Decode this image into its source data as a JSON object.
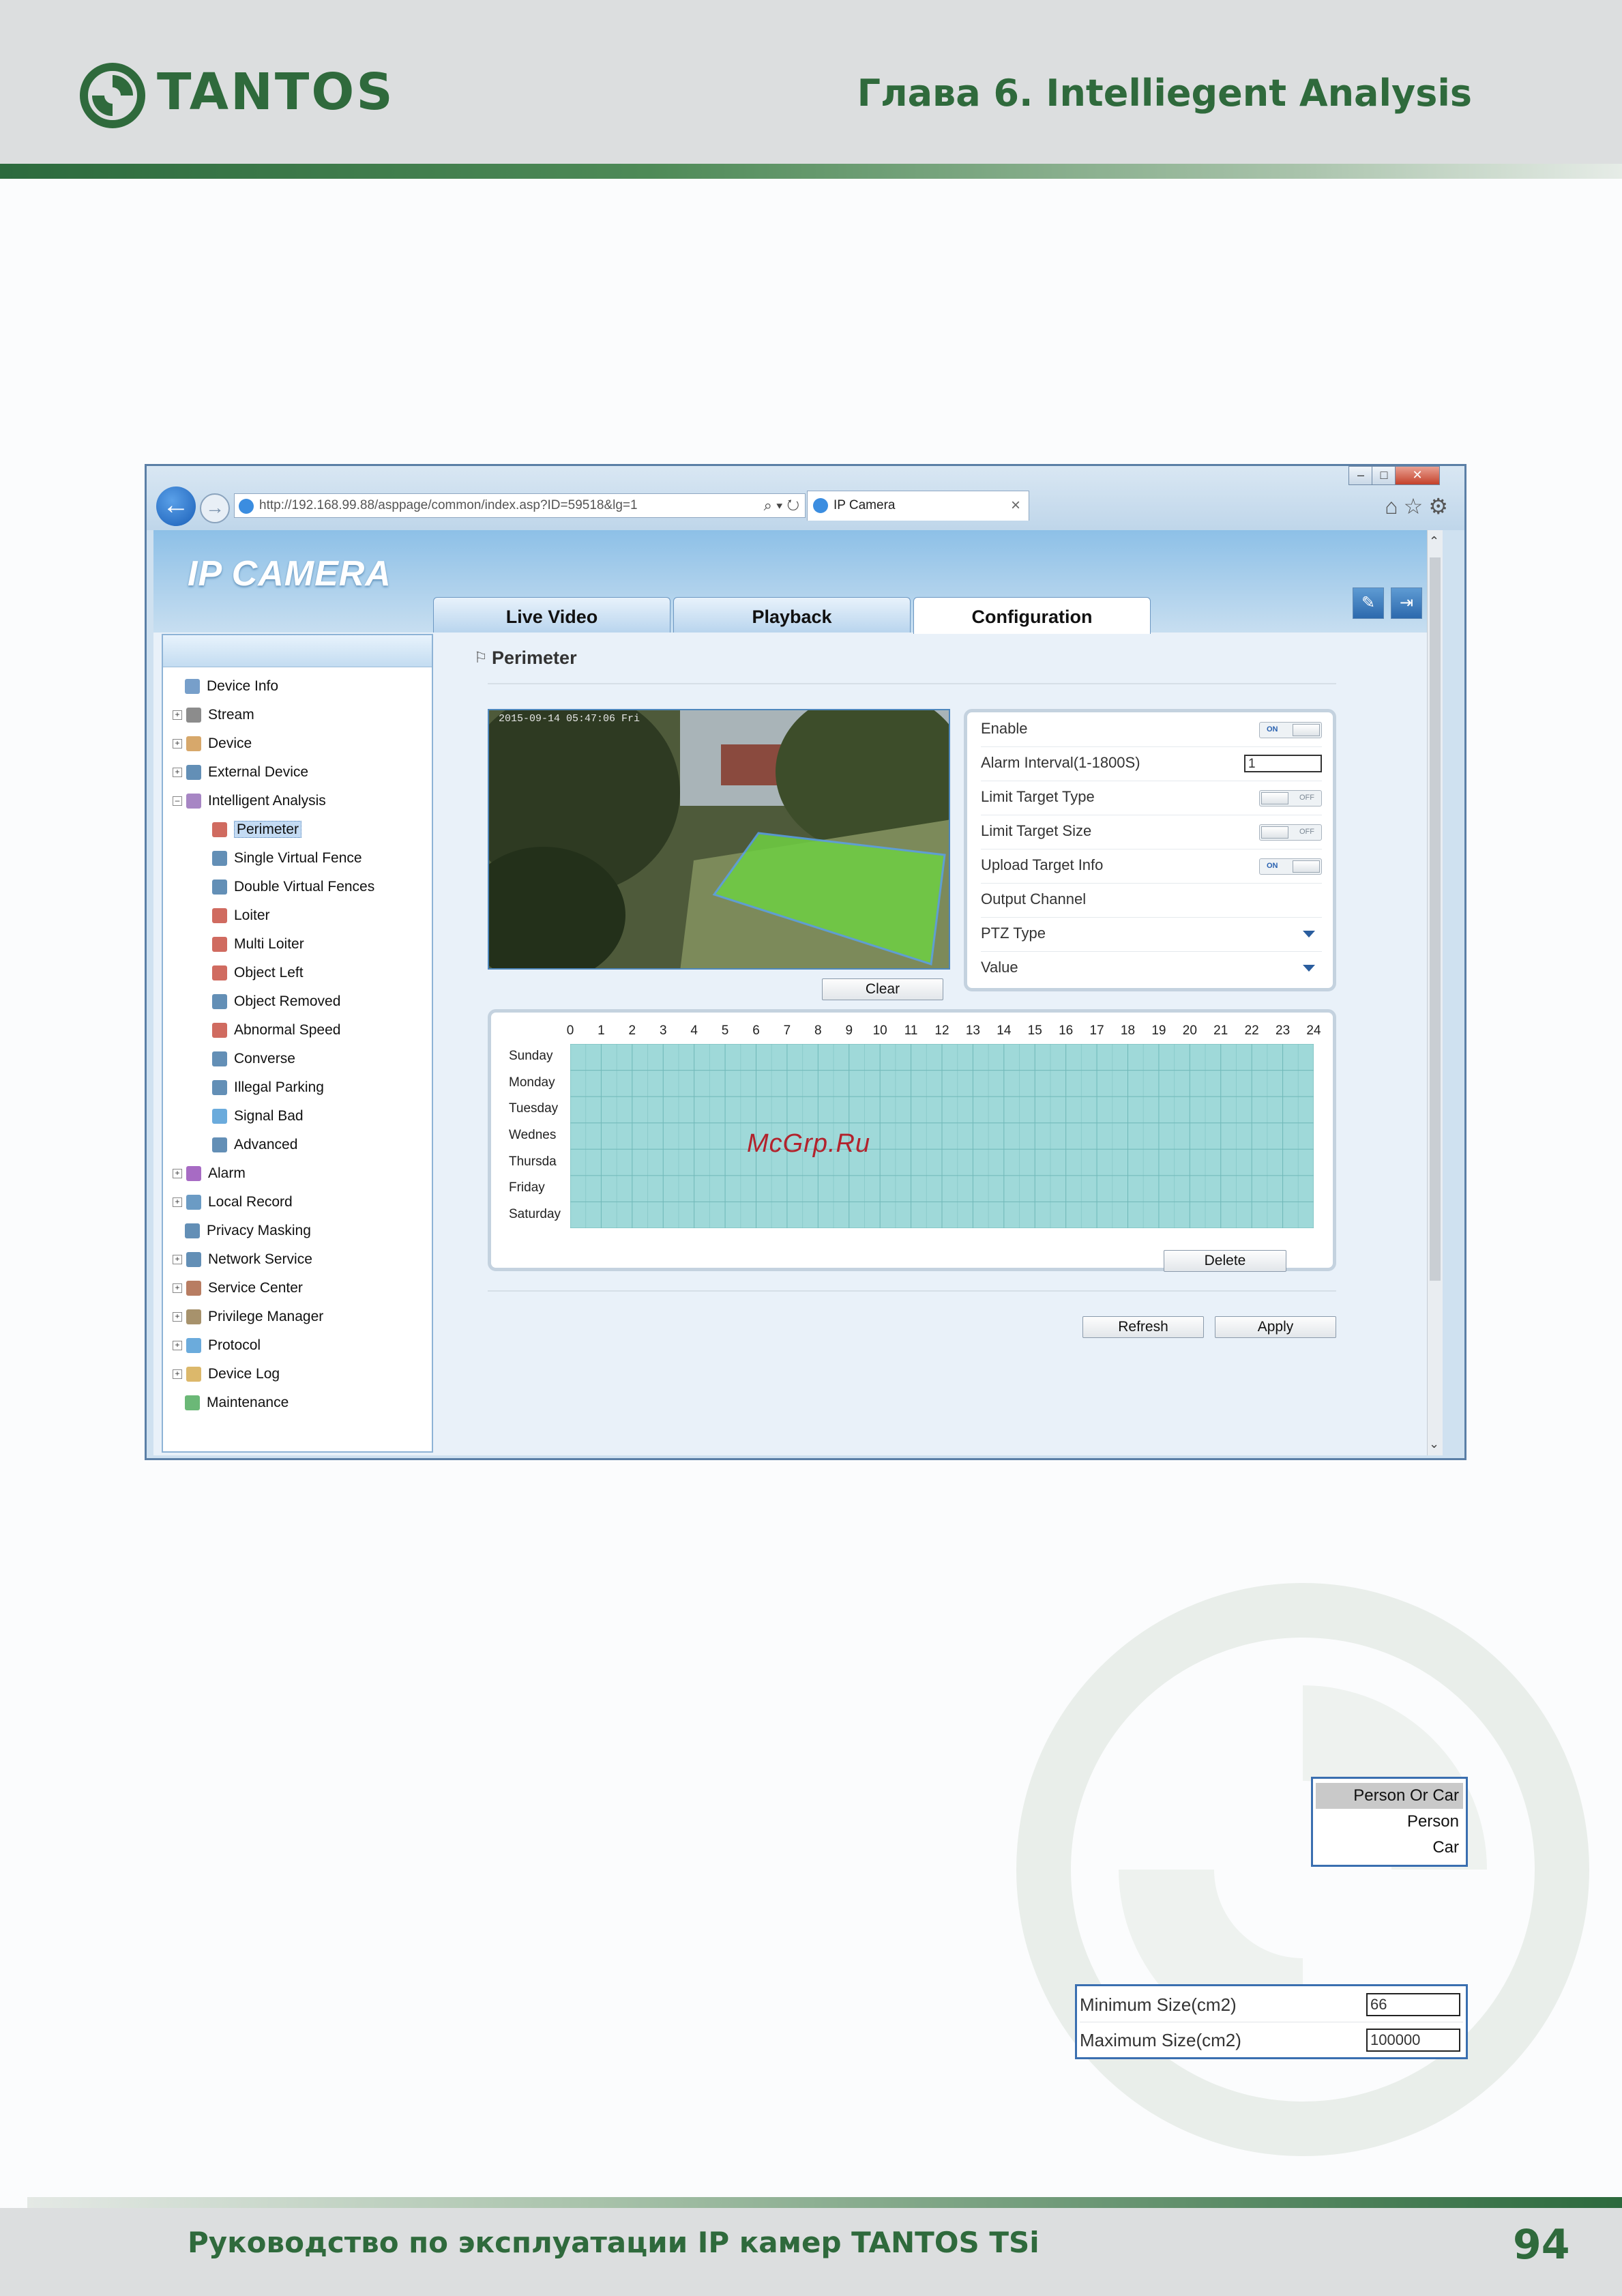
{
  "page": {
    "logo_text": "TANTOS",
    "chapter_title": "Глава 6. Intelliegent Analysis",
    "footer_text": "Руководство по эксплуатации IP камер TANTOS TSi",
    "page_number": "94",
    "watermark_text": "McGrp.Ru",
    "brand_color": "#2f6a3c"
  },
  "browser": {
    "address_url": "http://192.168.99.88/asppage/common/index.asp?ID=59518&lg=1",
    "tab_title": "IP Camera",
    "tab_close": "×",
    "window_controls": [
      "–",
      "□",
      "✕"
    ]
  },
  "app": {
    "brand": "IP CAMERA",
    "tabs": [
      {
        "label": "Live Video",
        "active": false
      },
      {
        "label": "Playback",
        "active": false
      },
      {
        "label": "Configuration",
        "active": true
      }
    ]
  },
  "sidebar": {
    "items": [
      {
        "label": "Device Info",
        "icon": "document-icon",
        "level": 0,
        "expander": ""
      },
      {
        "label": "Stream",
        "icon": "stream-icon",
        "level": 0,
        "expander": "+"
      },
      {
        "label": "Device",
        "icon": "device-icon",
        "level": 0,
        "expander": "+"
      },
      {
        "label": "External Device",
        "icon": "external-device-icon",
        "level": 0,
        "expander": "+"
      },
      {
        "label": "Intelligent Analysis",
        "icon": "analysis-icon",
        "level": 0,
        "expander": "–"
      },
      {
        "label": "Perimeter",
        "icon": "perimeter-icon",
        "level": 1,
        "expander": "",
        "selected": true
      },
      {
        "label": "Single Virtual Fence",
        "icon": "fence-icon",
        "level": 1,
        "expander": ""
      },
      {
        "label": "Double Virtual Fences",
        "icon": "double-fence-icon",
        "level": 1,
        "expander": ""
      },
      {
        "label": "Loiter",
        "icon": "loiter-icon",
        "level": 1,
        "expander": ""
      },
      {
        "label": "Multi Loiter",
        "icon": "multi-loiter-icon",
        "level": 1,
        "expander": ""
      },
      {
        "label": "Object Left",
        "icon": "object-left-icon",
        "level": 1,
        "expander": ""
      },
      {
        "label": "Object Removed",
        "icon": "object-removed-icon",
        "level": 1,
        "expander": ""
      },
      {
        "label": "Abnormal Speed",
        "icon": "speed-icon",
        "level": 1,
        "expander": ""
      },
      {
        "label": "Converse",
        "icon": "converse-icon",
        "level": 1,
        "expander": ""
      },
      {
        "label": "Illegal Parking",
        "icon": "parking-icon",
        "level": 1,
        "expander": ""
      },
      {
        "label": "Signal Bad",
        "icon": "signal-icon",
        "level": 1,
        "expander": ""
      },
      {
        "label": "Advanced",
        "icon": "advanced-icon",
        "level": 1,
        "expander": ""
      },
      {
        "label": "Alarm",
        "icon": "alarm-icon",
        "level": 0,
        "expander": "+"
      },
      {
        "label": "Local Record",
        "icon": "record-icon",
        "level": 0,
        "expander": "+"
      },
      {
        "label": "Privacy Masking",
        "icon": "privacy-icon",
        "level": 0,
        "expander": ""
      },
      {
        "label": "Network Service",
        "icon": "network-icon",
        "level": 0,
        "expander": "+"
      },
      {
        "label": "Service Center",
        "icon": "service-icon",
        "level": 0,
        "expander": "+"
      },
      {
        "label": "Privilege Manager",
        "icon": "privilege-icon",
        "level": 0,
        "expander": "+"
      },
      {
        "label": "Protocol",
        "icon": "protocol-icon",
        "level": 0,
        "expander": "+"
      },
      {
        "label": "Device Log",
        "icon": "log-icon",
        "level": 0,
        "expander": "+"
      },
      {
        "label": "Maintenance",
        "icon": "maintenance-icon",
        "level": 0,
        "expander": ""
      }
    ]
  },
  "perimeter": {
    "title": "Perimeter",
    "video_timestamp": "2015-09-14 05:47:06 Fri",
    "clear_label": "Clear",
    "settings": {
      "enable_label": "Enable",
      "enable_state": "ON",
      "alarm_interval_label": "Alarm Interval(1-1800S)",
      "alarm_interval_value": "1",
      "limit_type_label": "Limit Target Type",
      "limit_type_state": "OFF",
      "limit_size_label": "Limit Target Size",
      "limit_size_state": "OFF",
      "upload_info_label": "Upload Target Info",
      "upload_info_state": "ON",
      "output_channel_label": "Output Channel",
      "ptz_type_label": "PTZ Type",
      "value_label": "Value"
    },
    "schedule": {
      "hours": [
        "0",
        "1",
        "2",
        "3",
        "4",
        "5",
        "6",
        "7",
        "8",
        "9",
        "10",
        "11",
        "12",
        "13",
        "14",
        "15",
        "16",
        "17",
        "18",
        "19",
        "20",
        "21",
        "22",
        "23",
        "24"
      ],
      "days": [
        "Sunday",
        "Monday",
        "Tuesday",
        "Wednes",
        "Thursda",
        "Friday",
        "Saturday"
      ],
      "delete_label": "Delete"
    },
    "refresh_label": "Refresh",
    "apply_label": "Apply"
  },
  "target_type_dropdown": {
    "options": [
      {
        "label": "Person Or Car",
        "highlighted": true
      },
      {
        "label": "Person",
        "highlighted": false
      },
      {
        "label": "Car",
        "highlighted": false
      }
    ]
  },
  "target_size": {
    "min_label": "Minimum Size(cm2)",
    "min_value": "66",
    "max_label": "Maximum Size(cm2)",
    "max_value": "100000"
  }
}
